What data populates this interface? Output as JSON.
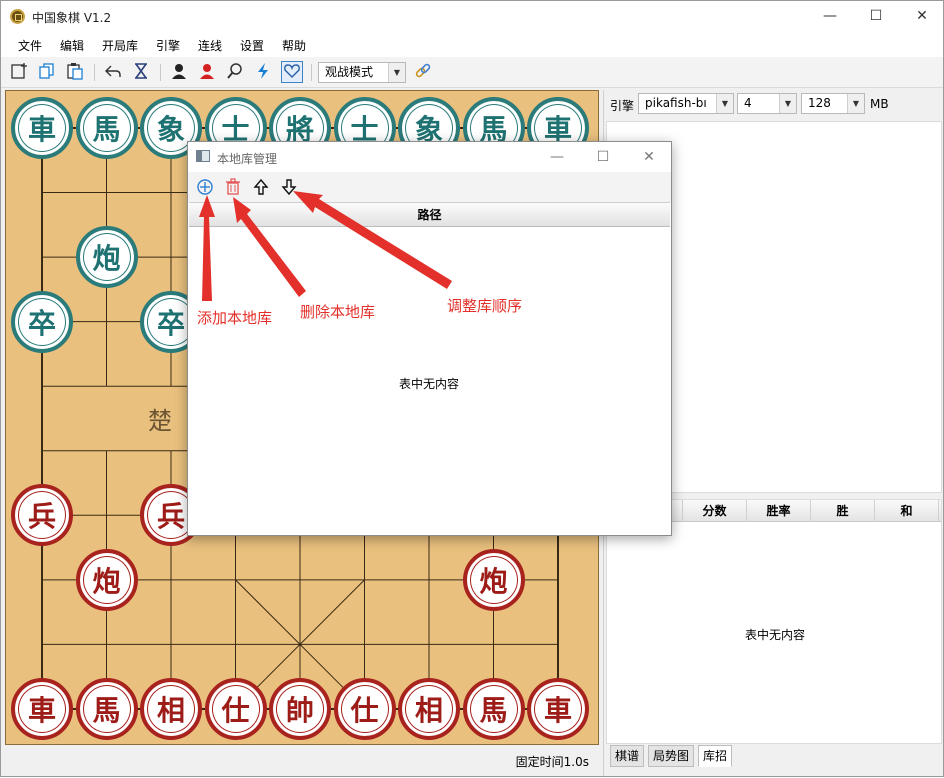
{
  "window": {
    "title": "中国象棋 V1.2",
    "minimize": "—",
    "maximize": "☐",
    "close": "✕"
  },
  "menu": [
    "文件",
    "编辑",
    "开局库",
    "引擎",
    "连线",
    "设置",
    "帮助"
  ],
  "toolbar": {
    "mode_select": "观战模式",
    "icons": [
      "new-board-icon",
      "copy-icon",
      "paste-icon",
      "undo-icon",
      "hourglass-icon",
      "black-player-icon",
      "red-player-icon",
      "search-icon",
      "lightning-icon",
      "heart-icon",
      "link-icon"
    ]
  },
  "board": {
    "river_left": "楚",
    "black_pieces": [
      {
        "char": "車",
        "col": 0,
        "row": 0
      },
      {
        "char": "馬",
        "col": 1,
        "row": 0
      },
      {
        "char": "象",
        "col": 2,
        "row": 0
      },
      {
        "char": "士",
        "col": 3,
        "row": 0
      },
      {
        "char": "將",
        "col": 4,
        "row": 0
      },
      {
        "char": "士",
        "col": 5,
        "row": 0
      },
      {
        "char": "象",
        "col": 6,
        "row": 0
      },
      {
        "char": "馬",
        "col": 7,
        "row": 0
      },
      {
        "char": "車",
        "col": 8,
        "row": 0
      },
      {
        "char": "炮",
        "col": 1,
        "row": 2
      },
      {
        "char": "卒",
        "col": 0,
        "row": 3
      },
      {
        "char": "卒",
        "col": 2,
        "row": 3
      }
    ],
    "red_pieces": [
      {
        "char": "兵",
        "col": 0,
        "row": 6
      },
      {
        "char": "兵",
        "col": 2,
        "row": 6
      },
      {
        "char": "炮",
        "col": 1,
        "row": 7
      },
      {
        "char": "炮",
        "col": 7,
        "row": 7
      },
      {
        "char": "車",
        "col": 0,
        "row": 9
      },
      {
        "char": "馬",
        "col": 1,
        "row": 9
      },
      {
        "char": "相",
        "col": 2,
        "row": 9
      },
      {
        "char": "仕",
        "col": 3,
        "row": 9
      },
      {
        "char": "帥",
        "col": 4,
        "row": 9
      },
      {
        "char": "仕",
        "col": 5,
        "row": 9
      },
      {
        "char": "相",
        "col": 6,
        "row": 9
      },
      {
        "char": "馬",
        "col": 7,
        "row": 9
      },
      {
        "char": "車",
        "col": 8,
        "row": 9
      }
    ],
    "colors": {
      "board": "#e9c07e",
      "black": "#2a7b7a",
      "red": "#a8221e"
    }
  },
  "status": {
    "text": "固定时间1.0s"
  },
  "engine": {
    "label": "引擎",
    "name": "pikafish-bı",
    "threads": "4",
    "hash": "128",
    "unit": "MB"
  },
  "book_table": {
    "columns": [
      "分数",
      "胜率",
      "胜",
      "和"
    ],
    "empty": "表中无内容"
  },
  "tabs": [
    "棋谱",
    "局势图",
    "库招"
  ],
  "dialog": {
    "title": "本地库管理",
    "minimize": "—",
    "maximize": "☐",
    "close": "✕",
    "column": "路径",
    "empty": "表中无内容"
  },
  "annotations": {
    "add": "添加本地库",
    "delete": "删除本地库",
    "reorder": "调整库顺序"
  }
}
